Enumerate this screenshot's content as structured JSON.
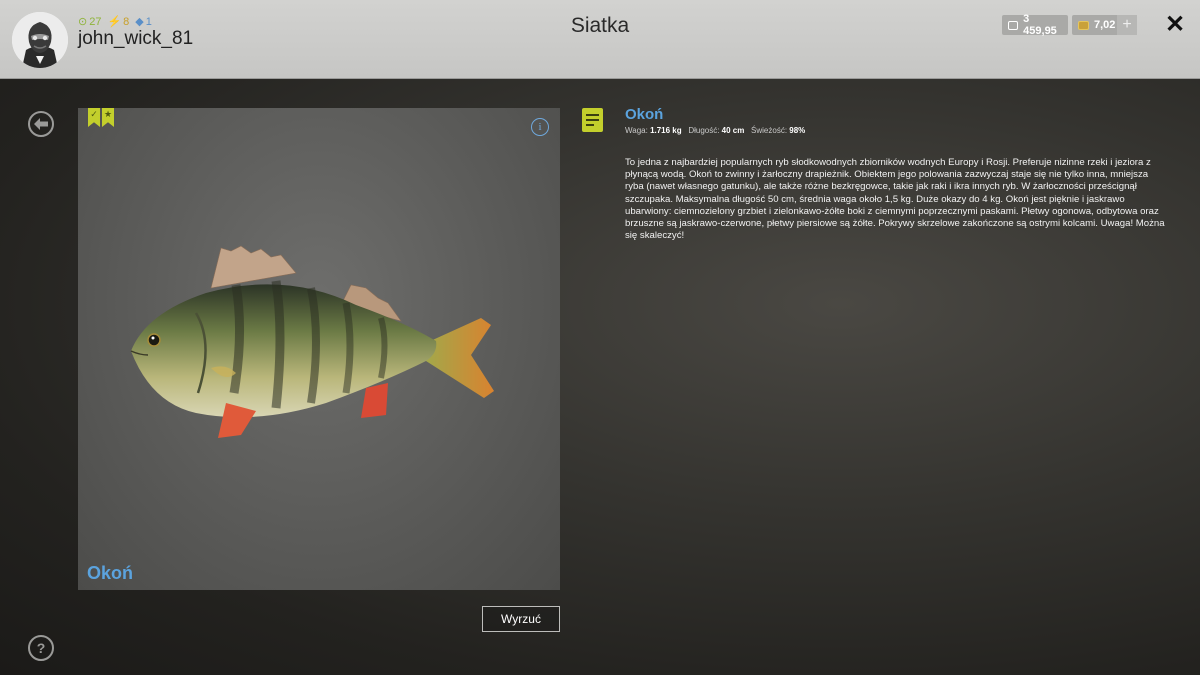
{
  "header": {
    "title": "Siatka",
    "username": "john_wick_81",
    "stats": {
      "level": "27",
      "energy": "8",
      "gems": "1"
    },
    "currency": {
      "silver": "3 459,95",
      "gold": "7,02"
    }
  },
  "icons": {
    "back": "back-arrow-icon",
    "help": "help-icon",
    "close": "close-icon",
    "info": "info-icon",
    "document": "document-icon"
  },
  "card": {
    "fish_name": "Okoń",
    "badges": [
      "check-badge",
      "star-badge"
    ]
  },
  "details": {
    "name": "Okoń",
    "weight_label": "Waga:",
    "weight": "1.716 kg",
    "length_label": "Długość:",
    "length": "40 cm",
    "freshness_label": "Świeżość:",
    "freshness": "98%",
    "description": "To jedna z najbardziej popularnych ryb słodkowodnych zbiorników wodnych Europy i Rosji. Preferuje nizinne rzeki i jeziora z płynącą wodą. Okoń to zwinny i żarłoczny drapieżnik. Obiektem jego polowania zazwyczaj staje się nie tylko inna, mniejsza ryba (nawet własnego gatunku), ale także różne bezkręgowce, takie jak raki i ikra innych ryb. W żarłoczności prześcignął szczupaka. Maksymalna długość 50 cm, średnia waga około 1,5 kg. Duże okazy do 4 kg. Okoń jest pięknie i jaskrawo ubarwiony: ciemnozielony grzbiet i zielonkawo-żółte boki z ciemnymi poprzecznymi paskami. Płetwy ogonowa, odbytowa oraz brzuszne są jaskrawo-czerwone, płetwy piersiowe są żółte. Pokrywy skrzelowe zakończone są ostrymi kolcami. Uwaga! Można się skaleczyć!"
  },
  "actions": {
    "discard": "Wyrzuć"
  }
}
